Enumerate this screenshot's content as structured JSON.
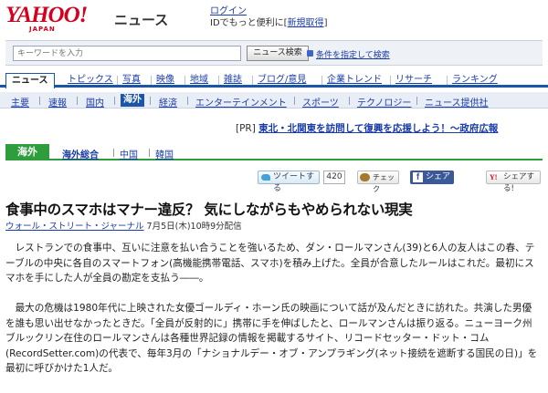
{
  "header": {
    "logo": "YAHOO!",
    "logo_sub": "JAPAN",
    "section": "ニュース",
    "login_label": "ログイン",
    "login_sub_prefix": "IDでもっと便利に",
    "signup_label": "新規取得"
  },
  "search": {
    "placeholder": "キーワードを入力",
    "button_label": "ニュース検索",
    "advanced_link": "条件を指定して検索"
  },
  "main_nav": {
    "items": [
      {
        "label": "ニュース",
        "active": true
      },
      {
        "label": "トピックス"
      },
      {
        "label": "写真"
      },
      {
        "label": "映像"
      },
      {
        "label": "地域"
      },
      {
        "label": "雑誌"
      },
      {
        "label": "ブログ/意見"
      },
      {
        "label": "企業トレンド"
      },
      {
        "label": "リサーチ"
      },
      {
        "label": "ランキング"
      }
    ]
  },
  "sub_nav": {
    "items": [
      {
        "label": "主要"
      },
      {
        "label": "速報"
      },
      {
        "label": "国内"
      },
      {
        "label": "海外",
        "active": true
      },
      {
        "label": "経済"
      },
      {
        "label": "エンターテインメント"
      },
      {
        "label": "スポーツ"
      },
      {
        "label": "テクノロジー"
      },
      {
        "label": "ニュース提供社"
      }
    ]
  },
  "pr": {
    "prefix": "[PR]",
    "link": "東北・北関東を訪問して復興を応援しよう！～政府広報"
  },
  "region": {
    "badge": "海外",
    "items": [
      {
        "label": "海外総合",
        "bold": true
      },
      {
        "label": "中国"
      },
      {
        "label": "韓国"
      }
    ]
  },
  "social": {
    "tweet_label": "ツイートする",
    "tweet_count": "420",
    "check_label": "チェック",
    "facebook_label": "シェア",
    "yahoo_share_label": "シェアする!"
  },
  "article": {
    "title": "食事中のスマホはマナー違反？ 気にしながらもやめられない現実",
    "source": "ウォール・ストリート・ジャーナル",
    "date": " 7月5日(木)10時9分配信",
    "paragraphs": [
      "　レストランでの食事中、互いに注意を払い合うことを強いるため、ダン・ロールマンさん(39)と6人の友人はこの春、テーブルの中央に各自のスマートフォン(高機能携帯電話、スマホ)を積み上げた。全員が合意したルールはこれだ。最初にスマホを手にした人が全員の勘定を支払う――。",
      "　最大の危機は1980年代に上映された女優ゴールディ・ホーン氏の映画について話が及んだときに訪れた。共演した男優を誰も思い出せなかったときだ。「全員が反射的に」携帯に手を伸ばしたと、ロールマンさんは振り返る。ニューヨーク州ブルックリン在住のロールマンさんは各種世界記録の情報を掲載するサイト、リコードセッター・ドット・コム(RecordSetter.com)の代表で、毎年3月の「ナショナルデー・オブ・アンプラギング(ネット接続を遮断する国民の日)」を最初に呼びかけた1人だ。"
    ]
  },
  "colors": {
    "brand_red": "#d4001e",
    "nav_blue": "#1a55a8",
    "link_blue": "#1a3ca8",
    "region_green": "#2e9e3c",
    "facebook_blue": "#3b5998"
  }
}
